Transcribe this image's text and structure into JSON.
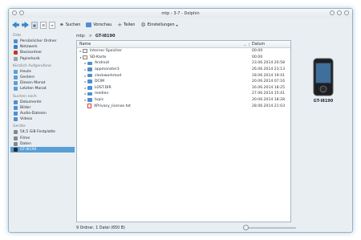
{
  "window": {
    "title": "mtp - 3-7 - Dolphin"
  },
  "toolbar": {
    "search_label": "Suchen",
    "preview_label": "Vorschau",
    "split_label": "Teilen",
    "settings_label": "Einstellungen"
  },
  "sidebar": {
    "sections": [
      {
        "title": "Orte",
        "items": [
          {
            "label": "Persönlicher Ordner",
            "icon": "home-folder-icon",
            "color": "#4f8fd0"
          },
          {
            "label": "Netzwerk",
            "icon": "network-icon",
            "color": "#3b7fc4"
          },
          {
            "label": "Basisordner",
            "icon": "root-folder-icon",
            "color": "#c0392b"
          },
          {
            "label": "Papierkorb",
            "icon": "trash-icon",
            "color": "#9aa4ab"
          }
        ]
      },
      {
        "title": "Kürzlich Aufgerufene",
        "items": [
          {
            "label": "Heute",
            "icon": "calendar-icon",
            "color": "#5a9fd6"
          },
          {
            "label": "Gestern",
            "icon": "calendar-icon",
            "color": "#5a9fd6"
          },
          {
            "label": "Diesen Monat",
            "icon": "calendar-icon",
            "color": "#5a9fd6"
          },
          {
            "label": "Letzten Monat",
            "icon": "calendar-icon",
            "color": "#5a9fd6"
          }
        ]
      },
      {
        "title": "Suchen nach",
        "items": [
          {
            "label": "Dokumente",
            "icon": "documents-icon",
            "color": "#4f8fd0"
          },
          {
            "label": "Bilder",
            "icon": "images-icon",
            "color": "#4f8fd0"
          },
          {
            "label": "Audio-Dateien",
            "icon": "audio-icon",
            "color": "#4f8fd0"
          },
          {
            "label": "Videos",
            "icon": "video-icon",
            "color": "#4f8fd0"
          }
        ]
      },
      {
        "title": "Geräte",
        "items": [
          {
            "label": "54,5 GiB Festplatte",
            "icon": "harddisk-icon",
            "color": "#7f8a93"
          },
          {
            "label": "Filme",
            "icon": "harddisk-icon",
            "color": "#7f8a93"
          },
          {
            "label": "Daten",
            "icon": "harddisk-icon",
            "color": "#7f8a93"
          },
          {
            "label": "GT-I8190",
            "icon": "phone-icon",
            "color": "#2a2a2a",
            "active": true
          }
        ]
      }
    ]
  },
  "breadcrumb": {
    "root": "mtp:",
    "sep": ">",
    "current": "GT-I8190"
  },
  "files": {
    "header": {
      "name": "Name",
      "date": "Datum"
    },
    "rows": [
      {
        "name": "Interner Speicher",
        "date": "00:00",
        "kind": "device",
        "indent": 0,
        "expander": "▸"
      },
      {
        "name": "SD-Karte",
        "date": "00:00",
        "kind": "device",
        "indent": 0,
        "expander": "▾"
      },
      {
        "name": "Android",
        "date": "23.06.2014 20:58",
        "kind": "folder",
        "indent": 1,
        "expander": "▸"
      },
      {
        "name": "appmonster3",
        "date": "26.06.2014 23:13",
        "kind": "folder",
        "indent": 1,
        "expander": "▸"
      },
      {
        "name": "clockworkmod",
        "date": "18.06.2014 19:41",
        "kind": "folder",
        "indent": 1,
        "expander": "▸"
      },
      {
        "name": "DCIM",
        "date": "20.06.2014 07:16",
        "kind": "folder",
        "indent": 1,
        "expander": "▸"
      },
      {
        "name": "LOST.DIR",
        "date": "16.06.2014 18:25",
        "kind": "folder",
        "indent": 1,
        "expander": "▸"
      },
      {
        "name": "medien",
        "date": "27.06.2014 15:41",
        "kind": "folder",
        "indent": 1,
        "expander": "▸"
      },
      {
        "name": "tvpic",
        "date": "20.06.2014 18:28",
        "kind": "folder",
        "indent": 1,
        "expander": "▸"
      },
      {
        "name": "XPrivacy_license.txt",
        "date": "28.06.2014 21:03",
        "kind": "file",
        "indent": 1,
        "expander": ""
      }
    ]
  },
  "info": {
    "device_name": "GT-I8190"
  },
  "status": {
    "text": "9 Ordner, 1 Datei (650 B)",
    "zoom": 0.0
  }
}
